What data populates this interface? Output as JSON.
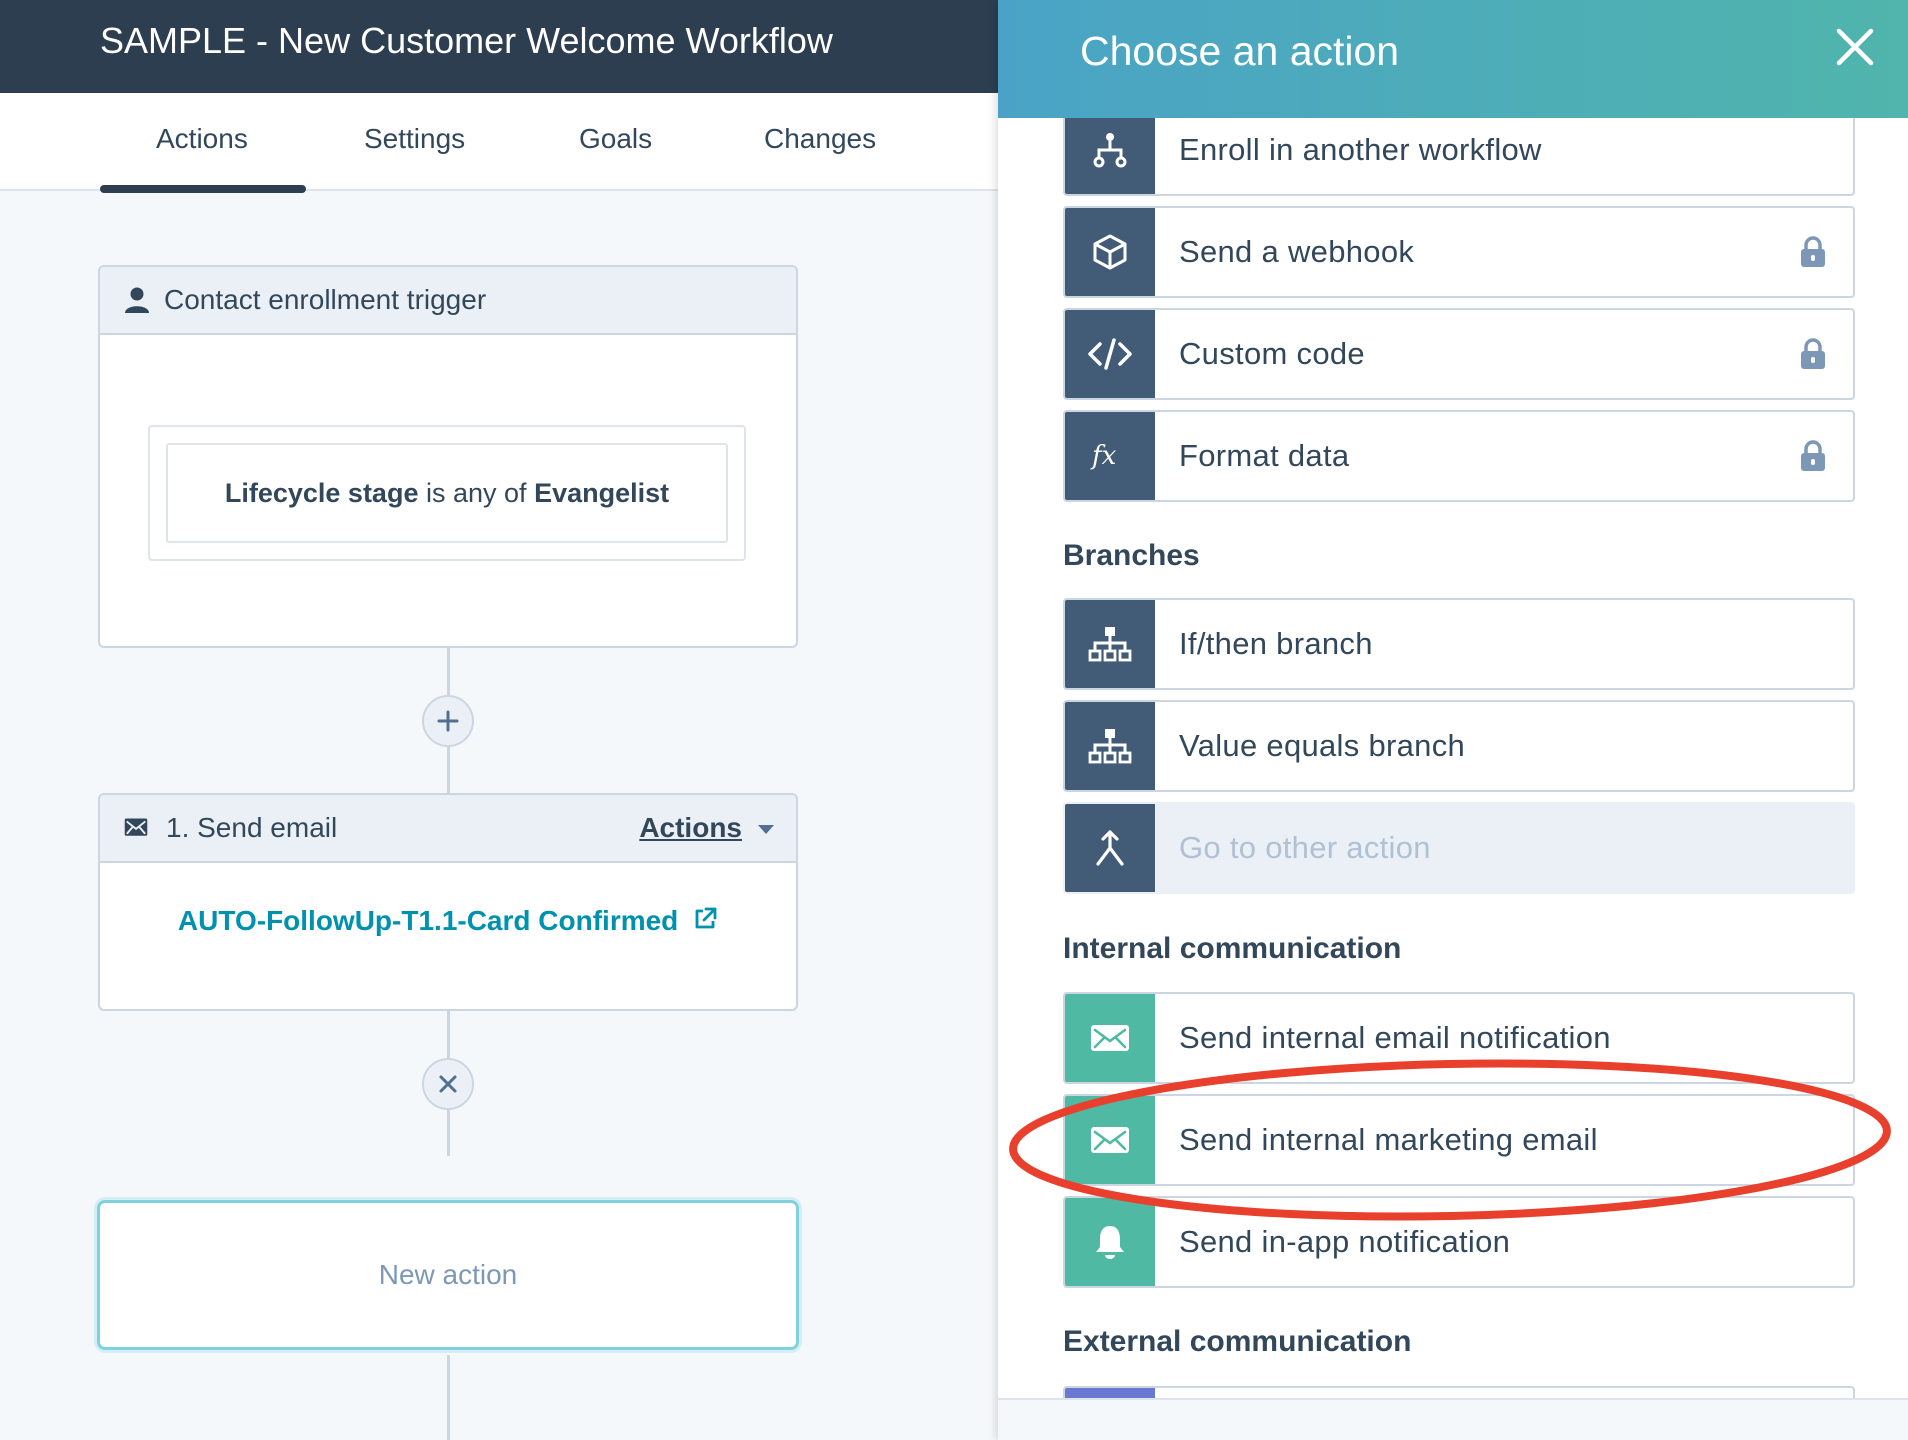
{
  "workflow": {
    "title": "SAMPLE - New Customer Welcome Workflow",
    "tabs": [
      {
        "label": "Actions",
        "active": true
      },
      {
        "label": "Settings",
        "active": false
      },
      {
        "label": "Goals",
        "active": false
      },
      {
        "label": "Changes",
        "active": false
      }
    ]
  },
  "trigger": {
    "header": "Contact enrollment trigger",
    "filter": {
      "property": "Lifecycle stage",
      "operator": "is any of",
      "value": "Evangelist"
    }
  },
  "step1": {
    "header": "1. Send email",
    "actions_label": "Actions",
    "email_name": "AUTO-FollowUp-T1.1-Card Confirmed"
  },
  "new_action": {
    "label": "New action"
  },
  "panel": {
    "title": "Choose an action",
    "top_options": [
      {
        "label": "Enroll in another workflow",
        "icon": "workflow-icon",
        "locked": false
      },
      {
        "label": "Send a webhook",
        "icon": "cube-icon",
        "locked": true
      },
      {
        "label": "Custom code",
        "icon": "code-icon",
        "locked": true
      },
      {
        "label": "Format data",
        "icon": "fx-icon",
        "locked": true
      }
    ],
    "branches": {
      "title": "Branches",
      "options": [
        {
          "label": "If/then branch",
          "icon": "branch-icon"
        },
        {
          "label": "Value equals branch",
          "icon": "branch-icon"
        },
        {
          "label": "Go to other action",
          "icon": "goto-icon",
          "disabled": true
        }
      ]
    },
    "internal": {
      "title": "Internal communication",
      "options": [
        {
          "label": "Send internal email notification",
          "icon": "envelope-icon"
        },
        {
          "label": "Send internal marketing email",
          "icon": "envelope-icon",
          "highlighted": true
        },
        {
          "label": "Send in-app notification",
          "icon": "bell-icon"
        }
      ]
    },
    "external": {
      "title": "External communication"
    }
  },
  "colors": {
    "header_dark": "#2d3e50",
    "panel_gradient_start": "#4aa3c6",
    "panel_gradient_end": "#50b5ac",
    "icon_slate": "#425b76",
    "icon_teal": "#4fb9a3",
    "link_blue": "#0091ae",
    "annotation_red": "#e8402c"
  }
}
